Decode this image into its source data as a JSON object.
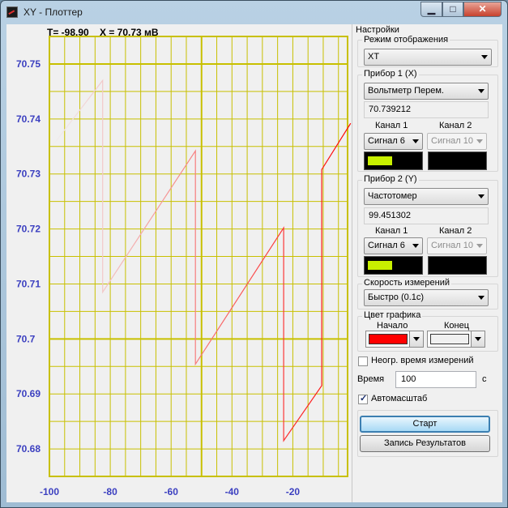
{
  "window": {
    "title": "XY - Плоттер",
    "icon": "plot-icon"
  },
  "caption_buttons": {
    "minimize": "▁",
    "maximize": "□",
    "close": "✕"
  },
  "readout": {
    "t_text": "T= -98.90",
    "x_text": "X =   70.73 мВ"
  },
  "chart_data": {
    "type": "line",
    "xlim": [
      -100,
      -2
    ],
    "ylim": [
      70.675,
      70.755
    ],
    "x_ticks": [
      "-100",
      "-80",
      "-60",
      "-40",
      "-20"
    ],
    "x_tick_values": [
      -100,
      -80,
      -60,
      -40,
      -20
    ],
    "y_ticks": [
      "70.75",
      "70.74",
      "70.73",
      "70.72",
      "70.71",
      "70.7",
      "70.69",
      "70.68"
    ],
    "y_tick_values": [
      70.75,
      70.74,
      70.73,
      70.72,
      70.71,
      70.7,
      70.69,
      70.68
    ],
    "grid": true,
    "grid_color": "#c8c000",
    "plot_bg": "#f0f0f0",
    "gradient_start_color": "#ff0000",
    "gradient_end_color": "#f0f0f0",
    "x": [
      -98.9,
      -82.5,
      -82.5,
      -52.0,
      -52.0,
      -23.0,
      -23.0,
      -10.5,
      -10.5,
      -1.0
    ],
    "y": [
      70.7352,
      70.747,
      70.7085,
      70.7342,
      70.6954,
      70.7202,
      70.6815,
      70.6915,
      70.7308,
      70.7392
    ]
  },
  "settings": {
    "group_title": "Настройки",
    "mode": {
      "label": "Режим отображения",
      "value": "XT"
    },
    "device1": {
      "title": "Прибор 1 (X)",
      "device": "Вольтметр Перем.",
      "reading": "70.739212",
      "ch1_label": "Канал 1",
      "ch2_label": "Канал 2",
      "ch1_value": "Сигнал 6",
      "ch2_value": "Сигнал 10",
      "ch1_indicator_color": "#c8f000"
    },
    "device2": {
      "title": "Прибор 2 (Y)",
      "device": "Частотомер",
      "reading": "99.451302",
      "ch1_label": "Канал 1",
      "ch2_label": "Канал 2",
      "ch1_value": "Сигнал 6",
      "ch2_value": "Сигнал 10",
      "ch1_indicator_color": "#c8f000"
    },
    "speed": {
      "title": "Скорость измерений",
      "value": "Быстро (0.1с)"
    },
    "color": {
      "title": "Цвет графика",
      "start_label": "Начало",
      "end_label": "Конец",
      "start_color": "#ff0000",
      "end_color": "#f0f0f0"
    },
    "unlimited_time": {
      "label": "Неогр. время измерений",
      "checked": false
    },
    "time": {
      "label": "Время",
      "value": "100",
      "unit": "с"
    },
    "autoscale": {
      "label": "Автомасштаб",
      "checked": true
    },
    "start_button": "Старт",
    "save_button": "Запись Результатов"
  }
}
